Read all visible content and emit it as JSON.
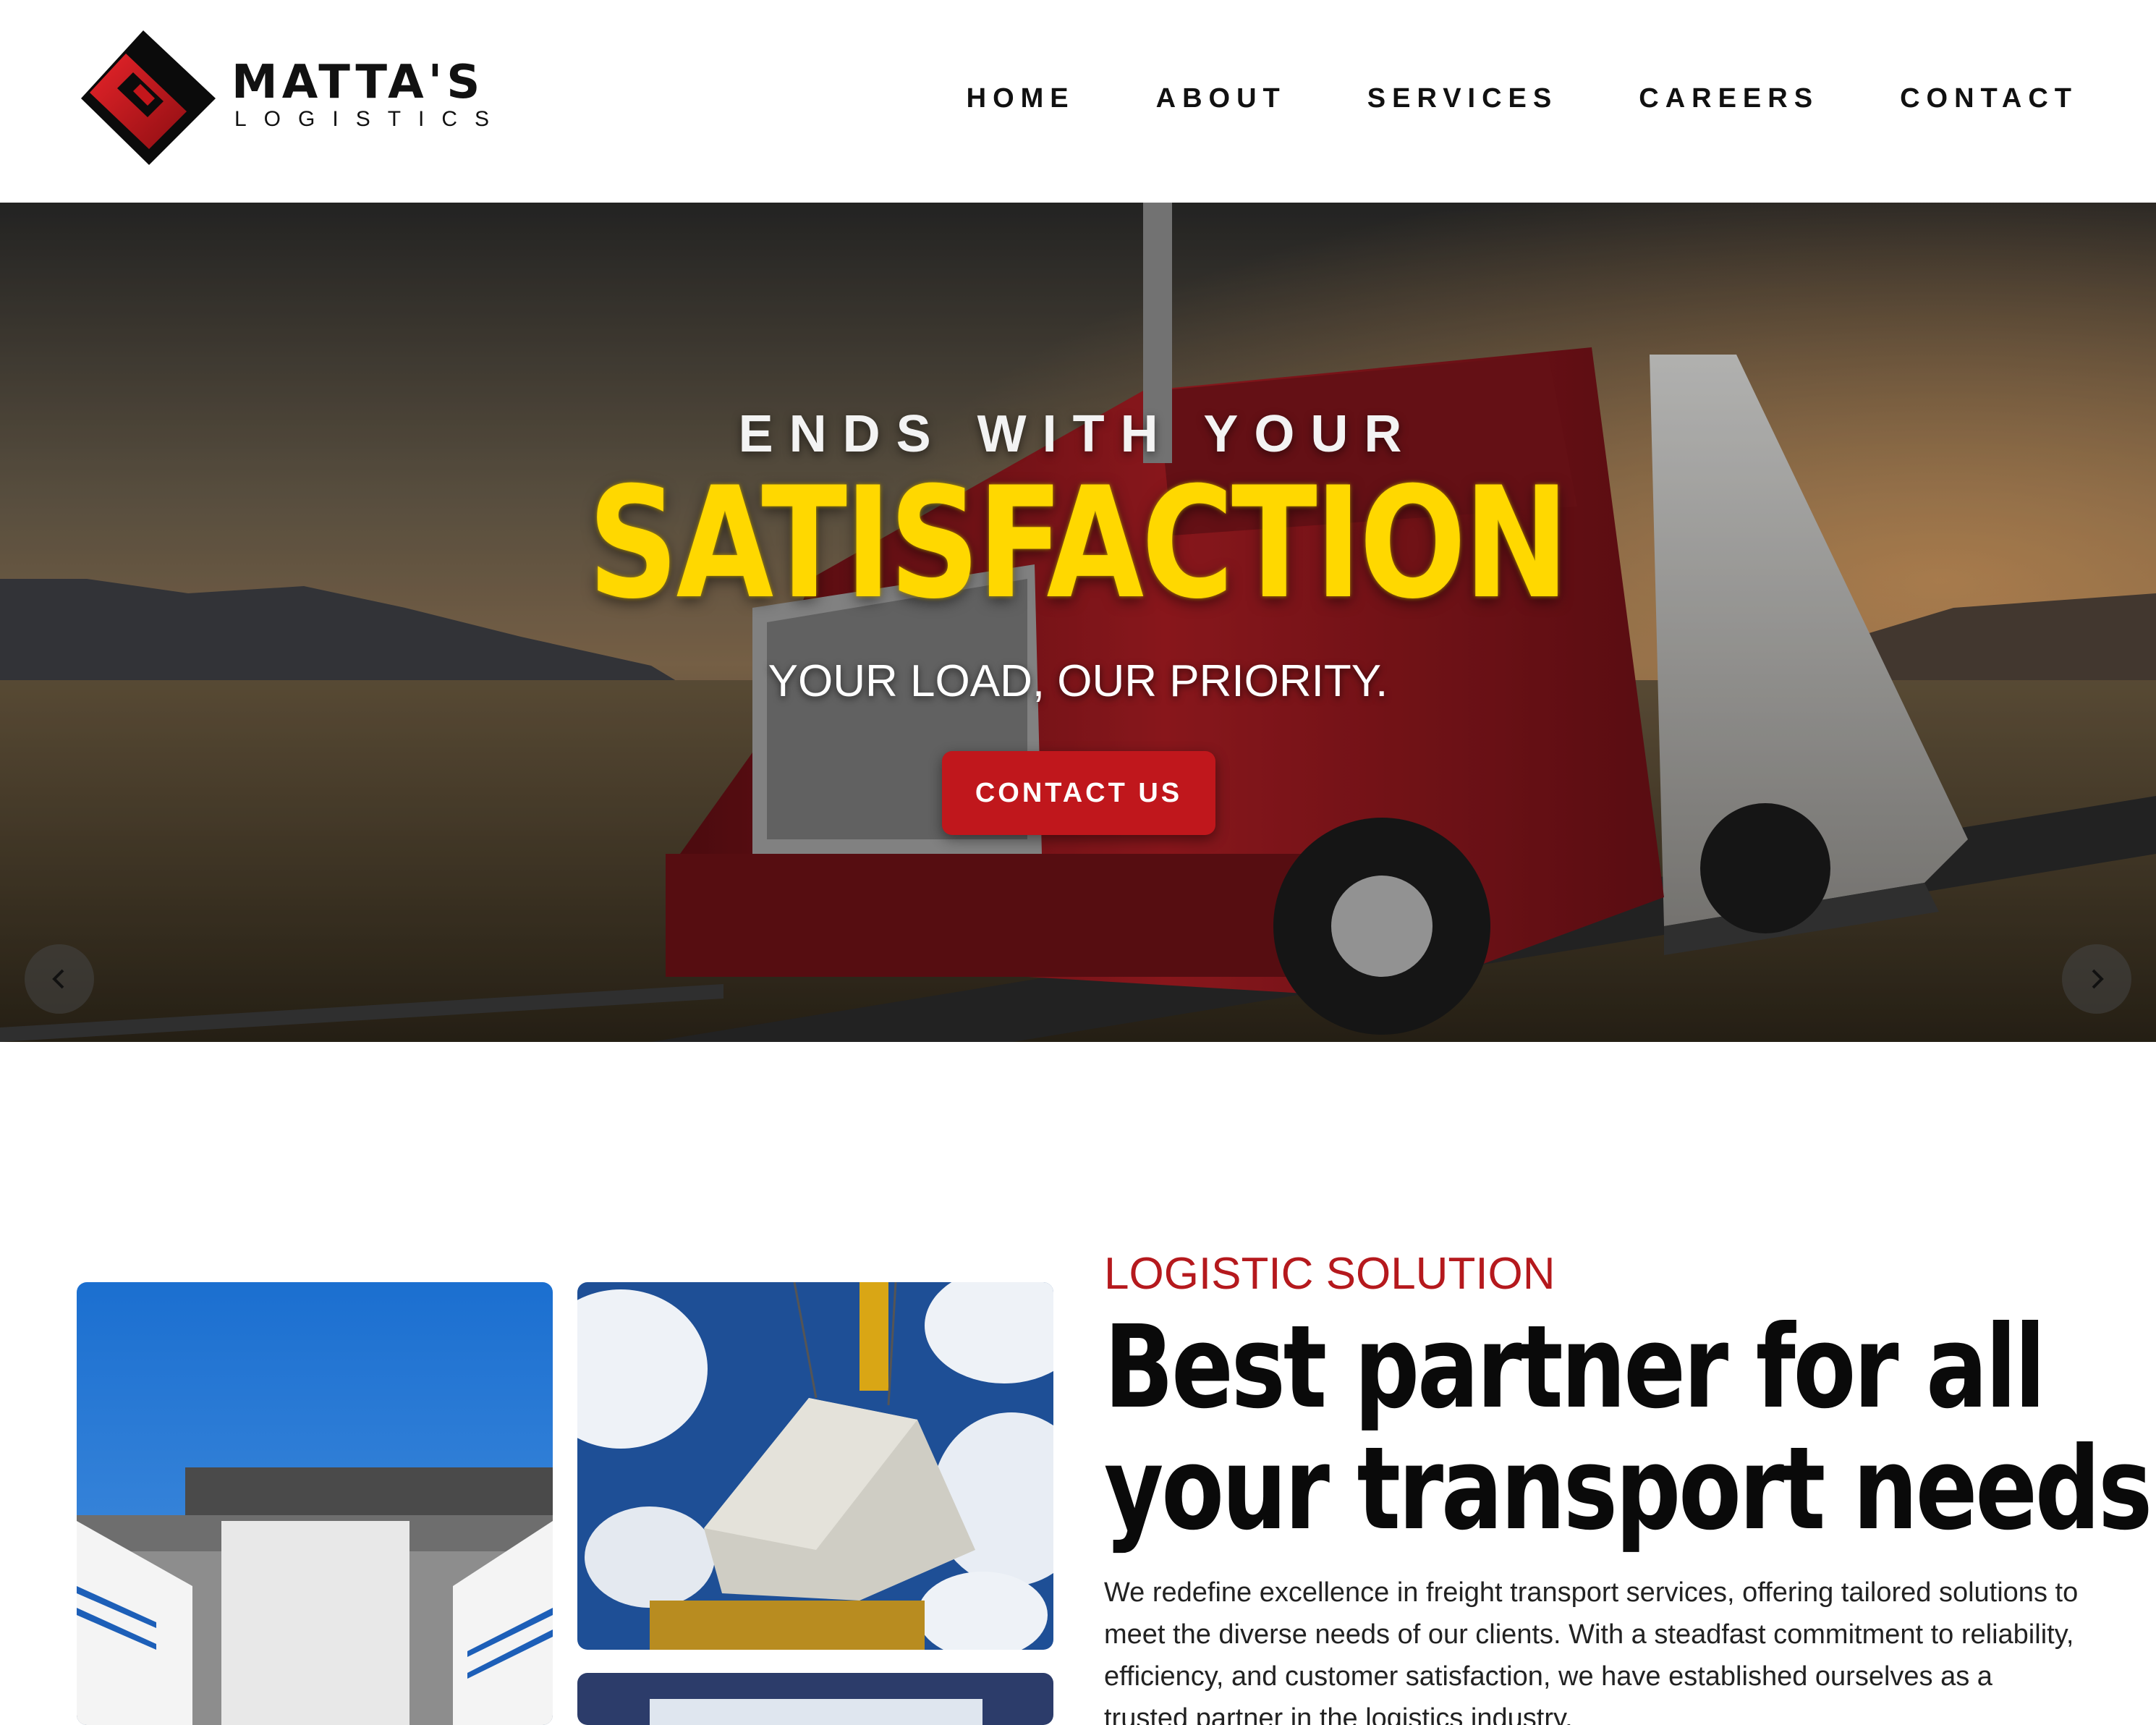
{
  "header": {
    "logo": {
      "name": "MATTA'S",
      "sub": "LOGISTICS"
    },
    "nav": [
      {
        "label": "HOME"
      },
      {
        "label": "ABOUT"
      },
      {
        "label": "SERVICES"
      },
      {
        "label": "CAREERS"
      },
      {
        "label": "CONTACT"
      }
    ]
  },
  "hero": {
    "kicker": "ENDS WITH YOUR",
    "headline": "SATISFACTION",
    "tagline": "YOUR LOAD, OUR PRIORITY.",
    "cta": "CONTACT US",
    "prev_icon": "chevron-left-icon",
    "next_icon": "chevron-right-icon",
    "accent_color": "#ffd800",
    "button_color": "#c0171c"
  },
  "about": {
    "eyebrow": "LOGISTIC SOLUTION",
    "headline_line1": "Best partner for all",
    "headline_line2": "your transport needs",
    "body": "We redefine excellence in freight transport services, offering tailored solutions to meet the diverse needs of our clients. With a steadfast commitment to reliability, efficiency, and customer satisfaction, we have established ourselves as a trusted partner in the logistics industry."
  },
  "brand_colors": {
    "red": "#c0171c",
    "dark": "#111111"
  }
}
